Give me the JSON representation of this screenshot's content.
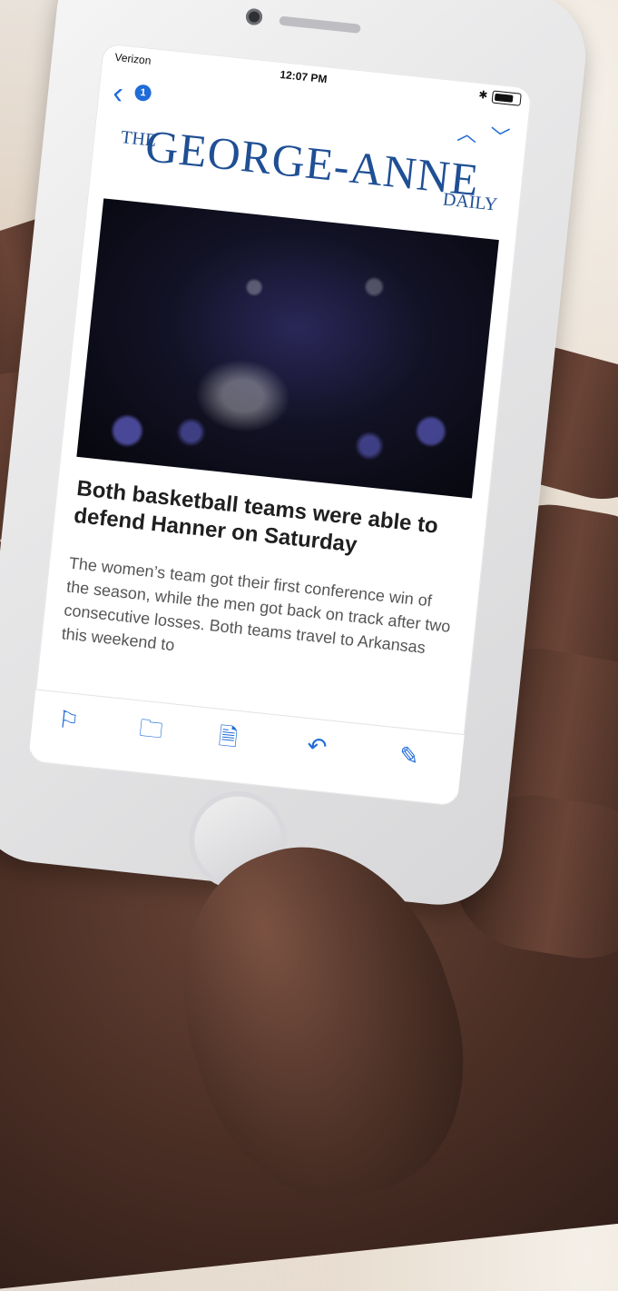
{
  "status_bar": {
    "carrier": "Verizon",
    "time": "12:07 PM"
  },
  "mail_nav": {
    "unread_count": "1"
  },
  "masthead": {
    "the": "THE",
    "name": "GEORGE-ANNE",
    "daily": "DAILY"
  },
  "article": {
    "headline": "Both basketball teams were able to defend Hanner on Saturday",
    "dek": "The women’s team got their first conference win of the season, while the men got back on track after two consecutive losses. Both teams travel to Arkansas this weekend to"
  },
  "toolbar": {
    "icons": [
      "flag-icon",
      "folder-icon",
      "move-icon",
      "reply-icon",
      "compose-icon"
    ]
  },
  "colors": {
    "accent": "#1f6bd8",
    "masthead": "#1f4f94"
  }
}
